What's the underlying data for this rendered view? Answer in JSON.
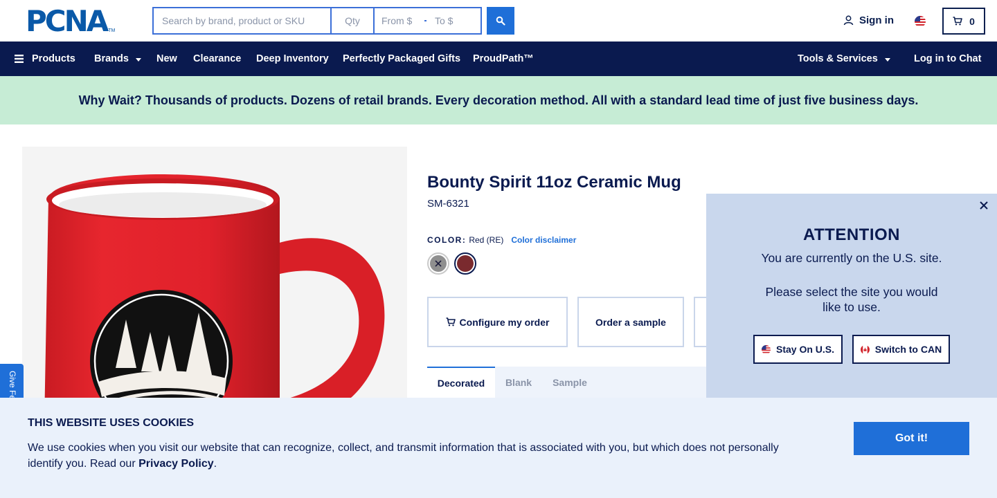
{
  "header": {
    "logo_text": "PCNA",
    "logo_tm": "TM",
    "search_placeholder": "Search by brand, product or SKU",
    "qty_placeholder": "Qty",
    "from_placeholder": "From $",
    "to_placeholder": "To $",
    "signin_label": "Sign in",
    "cart_count": "0"
  },
  "nav": {
    "products": "Products",
    "brands": "Brands",
    "new": "New",
    "clearance": "Clearance",
    "deep_inventory": "Deep Inventory",
    "gifts": "Perfectly Packaged Gifts",
    "proudpath": "ProudPath™",
    "tools": "Tools & Services",
    "chat": "Log in to Chat"
  },
  "banner": {
    "text": "Why Wait? Thousands of products. Dozens of retail brands. Every decoration method. All with a standard lead time of just five business days."
  },
  "product": {
    "title": "Bounty Spirit 11oz Ceramic Mug",
    "sku": "SM-6321",
    "color_label": "COLOR:",
    "color_value": "Red (RE)",
    "color_disclaimer": "Color disclaimer",
    "swatches": [
      {
        "name": "gray",
        "color": "#8f8f8f"
      },
      {
        "name": "red",
        "color": "#7a2a2e"
      }
    ],
    "configure_label": "Configure my order",
    "sample_label": "Order a sample",
    "tabs": [
      "Decorated",
      "Blank",
      "Sample"
    ]
  },
  "popup": {
    "title": "ATTENTION",
    "line1": "You are currently on the U.S. site.",
    "line2": "Please select the site you would like to use.",
    "stay_label": "Stay On U.S.",
    "switch_label": "Switch to CAN"
  },
  "feedback": {
    "label": "Give Feedback"
  },
  "cookie": {
    "title": "THIS WEBSITE USES COOKIES",
    "text": "We use cookies when you visit our website that can recognize, collect, and transmit information that is associated with you, but which does not personally identify you. Read our",
    "link": "Privacy Policy",
    "period": ".",
    "button": "Got it!"
  },
  "colors": {
    "navy": "#0a1a4f",
    "accent_blue": "#1f6fd8",
    "banner_green": "#c6ecd5",
    "popup_bg": "#c9d7ed",
    "cookie_bg": "#eaf1fb",
    "mug_red": "#e0212b"
  }
}
